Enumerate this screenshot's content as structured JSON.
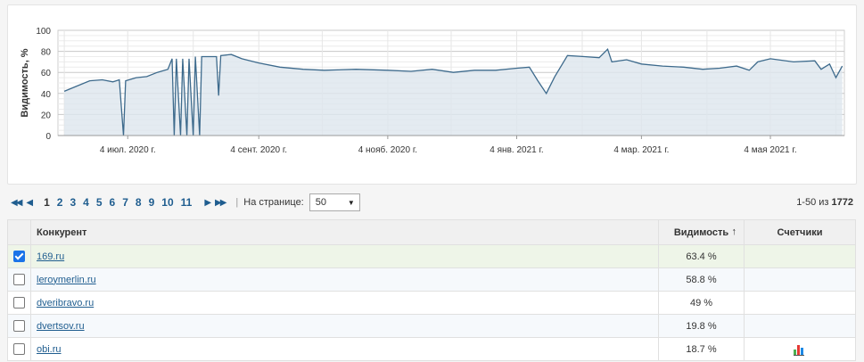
{
  "chart": {
    "ylabel": "Видимость, %",
    "yticks": [
      "100",
      "80",
      "60",
      "40",
      "20",
      "0"
    ],
    "xticks": [
      "4 июл. 2020 г.",
      "4 сент. 2020 г.",
      "4 нояб. 2020 г.",
      "4 янв. 2021 г.",
      "4 мар. 2021 г.",
      "4 мая 2021 г."
    ]
  },
  "chart_data": {
    "type": "area",
    "ylabel": "Видимость, %",
    "ylim": [
      0,
      100
    ],
    "grid": true,
    "x_tick_labels": [
      "4 июл. 2020 г.",
      "4 сент. 2020 г.",
      "4 нояб. 2020 г.",
      "4 янв. 2021 г.",
      "4 мар. 2021 г.",
      "4 мая 2021 г."
    ],
    "series": [
      {
        "points": [
          [
            "2020-06-04",
            42
          ],
          [
            "2020-06-10",
            47
          ],
          [
            "2020-06-16",
            52
          ],
          [
            "2020-06-22",
            53
          ],
          [
            "2020-06-27",
            51
          ],
          [
            "2020-06-30",
            53
          ],
          [
            "2020-07-02",
            0
          ],
          [
            "2020-07-03",
            52
          ],
          [
            "2020-07-08",
            55
          ],
          [
            "2020-07-13",
            56
          ],
          [
            "2020-07-18",
            60
          ],
          [
            "2020-07-23",
            63
          ],
          [
            "2020-07-25",
            73
          ],
          [
            "2020-07-26",
            0
          ],
          [
            "2020-07-27",
            73
          ],
          [
            "2020-07-29",
            0
          ],
          [
            "2020-07-30",
            73
          ],
          [
            "2020-08-01",
            0
          ],
          [
            "2020-08-02",
            73
          ],
          [
            "2020-08-04",
            0
          ],
          [
            "2020-08-05",
            75
          ],
          [
            "2020-08-07",
            0
          ],
          [
            "2020-08-08",
            75
          ],
          [
            "2020-08-12",
            75
          ],
          [
            "2020-08-15",
            75
          ],
          [
            "2020-08-16",
            38
          ],
          [
            "2020-08-17",
            76
          ],
          [
            "2020-08-22",
            77
          ],
          [
            "2020-08-27",
            73
          ],
          [
            "2020-09-04",
            69
          ],
          [
            "2020-09-14",
            65
          ],
          [
            "2020-09-25",
            63
          ],
          [
            "2020-10-05",
            62
          ],
          [
            "2020-10-20",
            63
          ],
          [
            "2020-11-04",
            62
          ],
          [
            "2020-11-15",
            61
          ],
          [
            "2020-11-25",
            63
          ],
          [
            "2020-12-05",
            60
          ],
          [
            "2020-12-15",
            62
          ],
          [
            "2020-12-25",
            62
          ],
          [
            "2021-01-04",
            64
          ],
          [
            "2021-01-10",
            65
          ],
          [
            "2021-01-14",
            52
          ],
          [
            "2021-01-18",
            40
          ],
          [
            "2021-01-22",
            56
          ],
          [
            "2021-01-28",
            76
          ],
          [
            "2021-02-05",
            75
          ],
          [
            "2021-02-12",
            74
          ],
          [
            "2021-02-16",
            82
          ],
          [
            "2021-02-18",
            70
          ],
          [
            "2021-02-25",
            72
          ],
          [
            "2021-03-04",
            68
          ],
          [
            "2021-03-14",
            66
          ],
          [
            "2021-03-24",
            65
          ],
          [
            "2021-04-02",
            63
          ],
          [
            "2021-04-10",
            64
          ],
          [
            "2021-04-18",
            66
          ],
          [
            "2021-04-24",
            62
          ],
          [
            "2021-04-28",
            70
          ],
          [
            "2021-05-04",
            73
          ],
          [
            "2021-05-15",
            70
          ],
          [
            "2021-05-25",
            71
          ],
          [
            "2021-05-28",
            63
          ],
          [
            "2021-06-01",
            68
          ],
          [
            "2021-06-04",
            55
          ],
          [
            "2021-06-07",
            66
          ]
        ]
      }
    ]
  },
  "pager": {
    "pages": [
      "1",
      "2",
      "3",
      "4",
      "5",
      "6",
      "7",
      "8",
      "9",
      "10",
      "11"
    ],
    "current_page": "1",
    "per_page_label": "На странице:",
    "per_page_value": "50",
    "range": "1-50 из",
    "total": "1772"
  },
  "table": {
    "columns": {
      "competitor": "Конкурент",
      "visibility": "Видимость",
      "sort": "↑",
      "counters": "Счетчики"
    },
    "rows": [
      {
        "name": "169.ru",
        "visibility": "63.4 %",
        "checked": true
      },
      {
        "name": "leroymerlin.ru",
        "visibility": "58.8 %",
        "checked": false
      },
      {
        "name": "dveribravo.ru",
        "visibility": "49 %",
        "checked": false
      },
      {
        "name": "dvertsov.ru",
        "visibility": "19.8 %",
        "checked": false
      },
      {
        "name": "obi.ru",
        "visibility": "18.7 %",
        "checked": false,
        "counter_icon": "bar-chart-icon"
      }
    ]
  },
  "colors": {
    "line": "#3d6a8c",
    "fill": "#dde6ee",
    "link": "#1f5d8f",
    "selected_row": "#eef5e8"
  }
}
